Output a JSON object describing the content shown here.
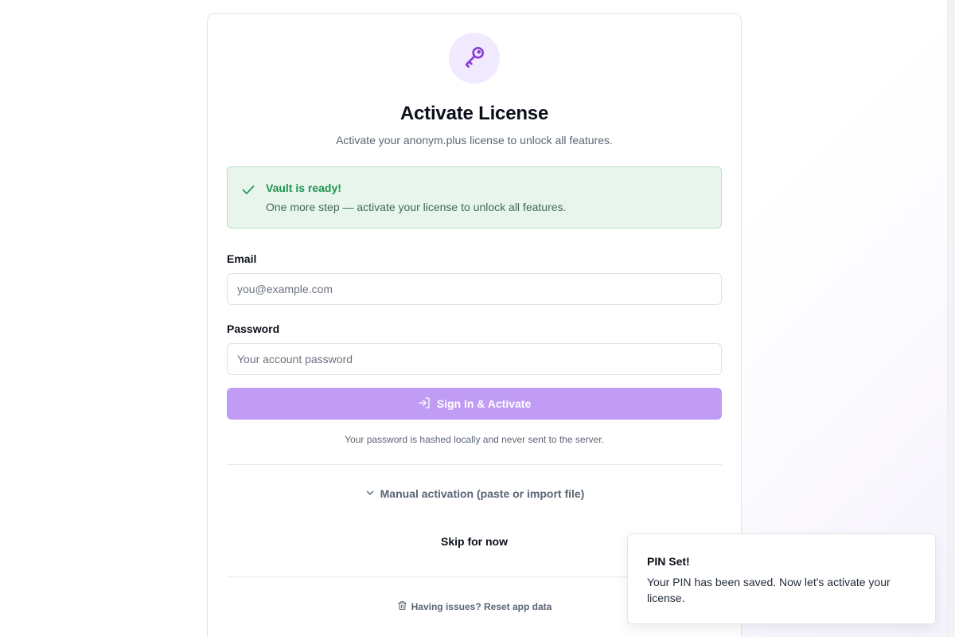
{
  "header": {
    "title": "Activate License",
    "subtitle": "Activate your anonym.plus license to unlock all features."
  },
  "alert": {
    "title": "Vault is ready!",
    "message": "One more step — activate your license to unlock all features.",
    "status": "success",
    "color": "#1f9350"
  },
  "form": {
    "email": {
      "label": "Email",
      "value": "",
      "placeholder": "you@example.com"
    },
    "password": {
      "label": "Password",
      "value": "",
      "placeholder": "Your account password"
    },
    "submit_label": "Sign In & Activate",
    "hint": "Your password is hashed locally and never sent to the server."
  },
  "manual": {
    "label": "Manual activation (paste or import file)",
    "expanded": false
  },
  "skip_label": "Skip for now",
  "reset_label": "Having issues? Reset app data",
  "toast": {
    "title": "PIN Set!",
    "message": "Your PIN has been saved. Now let's activate your license."
  },
  "icons": {
    "badge": "key-icon",
    "alert": "check-icon",
    "submit": "sign-in-icon",
    "manual": "chevron-down-icon",
    "reset": "trash-icon"
  },
  "colors": {
    "accent": "#9b5de5",
    "button": "#c09cf5",
    "badge_bg": "#f1e9fd",
    "success_bg": "#e8f5ec"
  }
}
